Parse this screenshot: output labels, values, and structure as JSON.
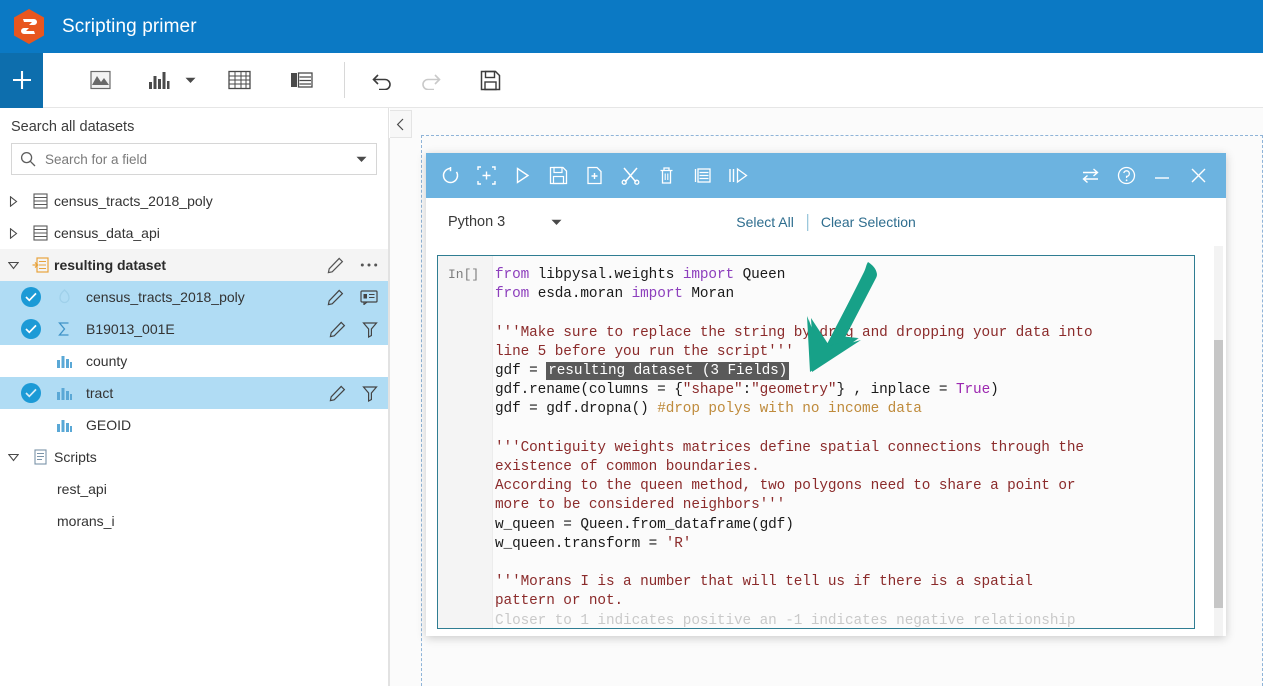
{
  "titlebar": {
    "app_name": "Scripting primer",
    "logo_icon": "arcgis-insights-hex-logo",
    "brand_color": "#0b79c4",
    "logo_color": "#e8561f"
  },
  "toolbar": {
    "add_label": "+",
    "items": [
      {
        "name": "map-icon",
        "label": "Map",
        "enabled": true
      },
      {
        "name": "chart-icon",
        "label": "Chart",
        "enabled": true
      },
      {
        "name": "chart-dropdown-caret",
        "label": "Chart options",
        "enabled": true
      },
      {
        "name": "table-icon",
        "label": "Table",
        "enabled": true
      },
      {
        "name": "cards-icon",
        "label": "Cards",
        "enabled": true
      },
      {
        "name": "undo-icon",
        "label": "Undo",
        "enabled": true
      },
      {
        "name": "redo-icon",
        "label": "Redo",
        "enabled": false
      },
      {
        "name": "save-icon",
        "label": "Save",
        "enabled": true
      }
    ]
  },
  "sidebar": {
    "heading": "Search all datasets",
    "search": {
      "placeholder": "Search for a field",
      "value": "",
      "icon": "search-icon",
      "dropdown_icon": "caret-down-icon"
    },
    "collapse_icon": "chevron-left-icon",
    "tree": [
      {
        "label": "census_tracts_2018_poly",
        "icon": "dataset-table-icon",
        "twisty": "collapsed",
        "level": 0,
        "selected": false,
        "checked": false,
        "bold": false,
        "actions": []
      },
      {
        "label": "census_data_api",
        "icon": "dataset-table-icon",
        "twisty": "collapsed",
        "level": 0,
        "selected": false,
        "checked": false,
        "bold": false,
        "actions": []
      },
      {
        "label": "resulting dataset",
        "icon": "result-dataset-icon",
        "twisty": "expanded",
        "level": 0,
        "selected": false,
        "highlighted": true,
        "checked": false,
        "bold": true,
        "actions": [
          "pencil-icon",
          "ellipsis-icon"
        ]
      },
      {
        "label": "census_tracts_2018_poly",
        "icon": "geometry-field-icon",
        "twisty": "none",
        "level": 1,
        "selected": true,
        "checked": true,
        "bold": false,
        "actions": [
          "pencil-icon",
          "info-card-icon"
        ]
      },
      {
        "label": "B19013_001E",
        "icon": "sigma-field-icon",
        "twisty": "none",
        "level": 1,
        "selected": true,
        "checked": true,
        "bold": false,
        "actions": [
          "pencil-icon",
          "filter-icon"
        ]
      },
      {
        "label": "county",
        "icon": "string-field-icon",
        "twisty": "none",
        "level": 1,
        "selected": false,
        "checked": false,
        "bold": false,
        "actions": []
      },
      {
        "label": "tract",
        "icon": "string-field-icon",
        "twisty": "none",
        "level": 1,
        "selected": true,
        "checked": true,
        "bold": false,
        "actions": [
          "pencil-icon",
          "filter-icon"
        ]
      },
      {
        "label": "GEOID",
        "icon": "string-field-icon",
        "twisty": "none",
        "level": 1,
        "selected": false,
        "checked": false,
        "bold": false,
        "actions": []
      },
      {
        "label": "Scripts",
        "icon": "scripts-icon",
        "twisty": "expanded",
        "level": 0,
        "selected": false,
        "checked": false,
        "bold": false,
        "actions": []
      },
      {
        "label": "rest_api",
        "icon": "none",
        "twisty": "none",
        "level": 1,
        "selected": false,
        "checked": false,
        "bold": false,
        "actions": []
      },
      {
        "label": "morans_i",
        "icon": "none",
        "twisty": "none",
        "level": 1,
        "selected": false,
        "checked": false,
        "bold": false,
        "actions": []
      }
    ]
  },
  "notebook": {
    "titlebar_color": "#6cb3e0",
    "left_icons": [
      {
        "name": "restart-kernel-icon",
        "label": "Restart kernel"
      },
      {
        "name": "select-cell-icon",
        "label": "Select cell"
      },
      {
        "name": "run-icon",
        "label": "Run"
      },
      {
        "name": "save-notebook-icon",
        "label": "Save"
      },
      {
        "name": "new-cell-icon",
        "label": "New cell"
      },
      {
        "name": "cut-icon",
        "label": "Cut"
      },
      {
        "name": "delete-icon",
        "label": "Delete"
      },
      {
        "name": "merge-cells-icon",
        "label": "Merge cells"
      },
      {
        "name": "run-all-icon",
        "label": "Run all"
      }
    ],
    "right_icons": [
      {
        "name": "sync-icon",
        "label": "Sync"
      },
      {
        "name": "help-icon",
        "label": "Help"
      },
      {
        "name": "minimize-icon",
        "label": "Minimize"
      },
      {
        "name": "close-icon",
        "label": "Close"
      }
    ],
    "kernel": {
      "name": "Python 3",
      "caret_icon": "caret-down-icon"
    },
    "select_all": "Select All",
    "clear_selection": "Clear Selection",
    "prompt": "In[]",
    "highlight_token": "resulting dataset (3 Fields)",
    "code_lines": [
      "from libpysal.weights import Queen",
      "from esda.moran import Moran",
      "",
      "'''Make sure to replace the string by drag and dropping your data into",
      "line 5 before you run the script'''",
      "gdf = resulting dataset (3 Fields)",
      "gdf.rename(columns = {\"shape\":\"geometry\"} , inplace = True)",
      "gdf = gdf.dropna() #drop polys with no income data",
      "",
      "'''Contiguity weights matrices define spatial connections through the",
      "existence of common boundaries.",
      "According to the queen method, two polygons need to share a point or",
      "more to be considered neighbors'''",
      "w_queen = Queen.from_dataframe(gdf)",
      "w_queen.transform = 'R'",
      "",
      "'''Morans I is a number that will tell us if there is a spatial",
      "pattern or not.",
      "Closer to 1 indicates positive an -1 indicates negative relationship"
    ]
  },
  "annotation": {
    "arrow_icon": "green-pointer-arrow",
    "arrow_color": "#17a188"
  }
}
